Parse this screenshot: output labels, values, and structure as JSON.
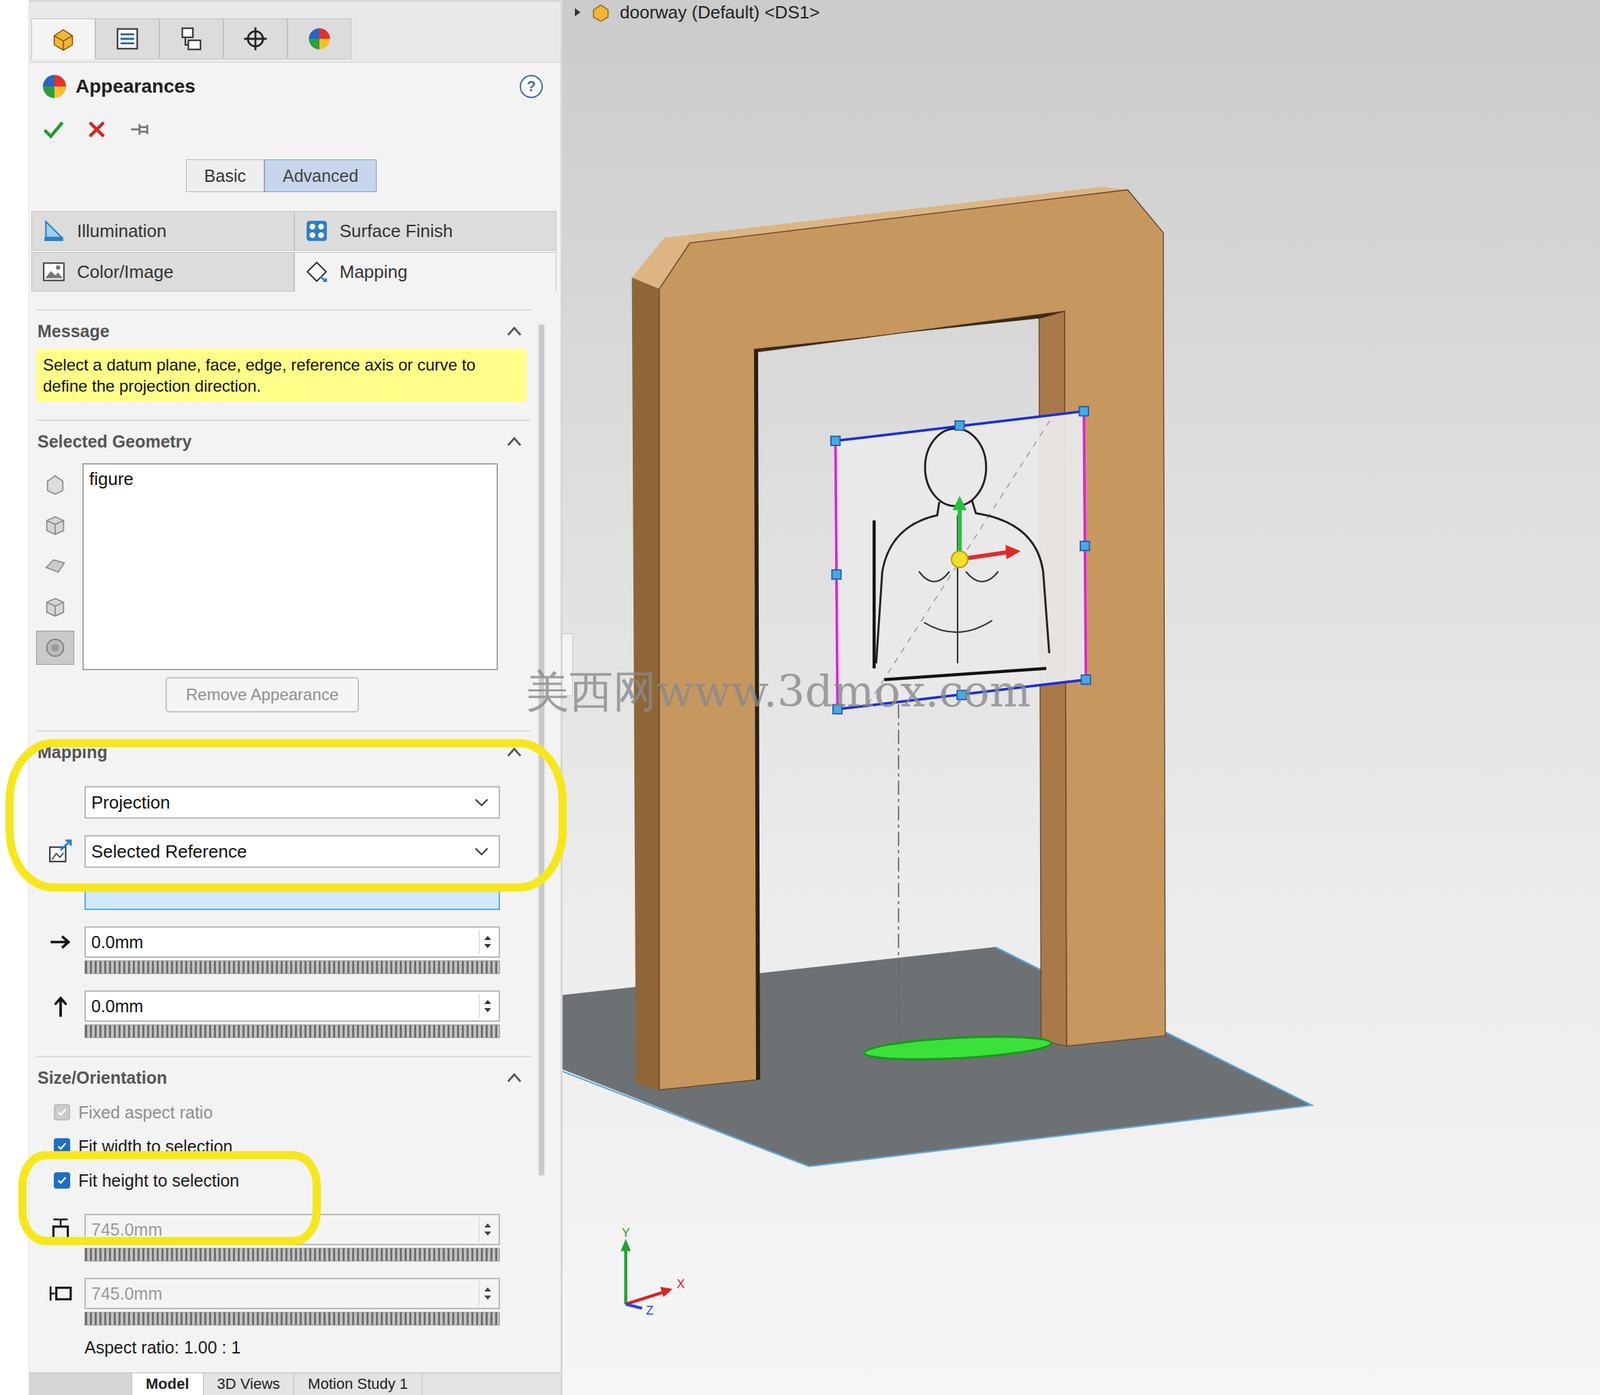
{
  "viewport": {
    "breadcrumb": "doorway (Default) <DS1>",
    "watermark": "美西网www.3dmox.com",
    "axes": [
      "Y",
      "X",
      "Z"
    ]
  },
  "toolbar": [
    {
      "selected": true
    },
    {
      "selected": false
    },
    {
      "selected": false
    },
    {
      "selected": false
    },
    {
      "selected": false
    }
  ],
  "panel": {
    "title": "Appearances",
    "help": "?",
    "modes": [
      {
        "label": "Basic",
        "selected": false
      },
      {
        "label": "Advanced",
        "selected": true
      }
    ],
    "tabs": [
      {
        "label": "Illumination",
        "selected": false
      },
      {
        "label": "Surface Finish",
        "selected": false
      },
      {
        "label": "Color/Image",
        "selected": false
      },
      {
        "label": "Mapping",
        "selected": true
      }
    ],
    "message": {
      "title": "Message",
      "expanded": true,
      "text": "Select a datum plane, face, edge, reference axis or curve to define the projection direction."
    },
    "geometry": {
      "title": "Selected Geometry",
      "expanded": true,
      "items": [
        "figure"
      ],
      "filters": [
        {
          "selected": false
        },
        {
          "selected": false
        },
        {
          "selected": false
        },
        {
          "selected": false
        },
        {
          "selected": true
        }
      ],
      "remove_button": {
        "label": "Remove Appearance",
        "disabled": true
      }
    },
    "mapping": {
      "title": "Mapping",
      "expanded": true,
      "style": "Projection",
      "reference": "Selected Reference",
      "reference_value": "",
      "offsets": [
        {
          "kind": "horizontal",
          "value": "0.0mm"
        },
        {
          "kind": "vertical",
          "value": "0.0mm"
        }
      ]
    },
    "size": {
      "title": "Size/Orientation",
      "expanded": true,
      "checks": [
        {
          "label": "Fixed aspect ratio",
          "checked": true,
          "disabled": true
        },
        {
          "label": "Fit width to selection",
          "checked": true,
          "disabled": false
        },
        {
          "label": "Fit height to selection",
          "checked": true,
          "disabled": false
        }
      ],
      "dims": [
        {
          "kind": "height",
          "value": "745.0mm",
          "disabled": true
        },
        {
          "kind": "width",
          "value": "745.0mm",
          "disabled": true
        }
      ],
      "aspect": "Aspect ratio: 1.00 : 1"
    }
  },
  "bottom_tabs": [
    {
      "label": "Model",
      "selected": true
    },
    {
      "label": "3D Views",
      "selected": false
    },
    {
      "label": "Motion Study 1",
      "selected": false
    }
  ]
}
